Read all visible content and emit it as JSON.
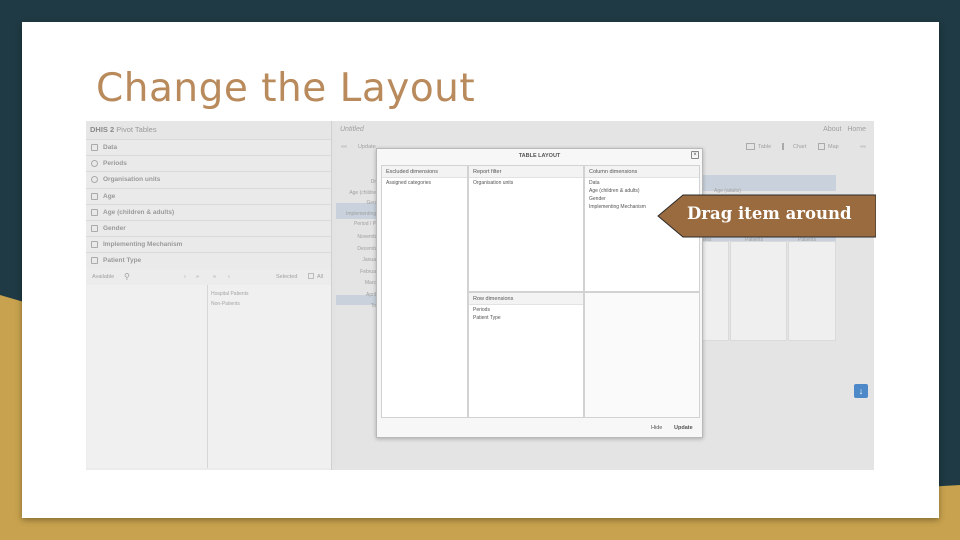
{
  "slide": {
    "title": "Change the Layout"
  },
  "app": {
    "brand": "DHIS 2",
    "name": "Pivot Tables",
    "accordion": [
      "Data",
      "Periods",
      "Organisation units",
      "Age",
      "Age (children & adults)",
      "Gender",
      "Implementing Mechanism",
      "Patient Type"
    ],
    "selector": {
      "available": "Available",
      "selected": "Selected",
      "all": "All"
    },
    "selected_items": [
      "Hospital Patients",
      "Non-Patients"
    ]
  },
  "main": {
    "favorite": "Untitled",
    "about": "About",
    "home": "Home",
    "update": "Update",
    "table": "Table",
    "chart": "Chart",
    "map": "Map",
    "grid": {
      "row_header_labels": [
        "Dr",
        "Age (childre",
        "Gen",
        "Implementing",
        "Period / P"
      ],
      "row_labels": [
        "Novemb",
        "Decemb",
        "Janua",
        "Februa",
        "Marc",
        "April",
        "To"
      ],
      "col_header": "Age (adults)",
      "col_labels": [
        "ents",
        "Patients",
        "Patients"
      ]
    }
  },
  "modal": {
    "title": "TABLE LAYOUT",
    "excluded": {
      "header": "Excluded dimensions",
      "items": [
        "Assigned categories"
      ]
    },
    "filter": {
      "header": "Report filter",
      "items": [
        "Organisation units"
      ]
    },
    "columns": {
      "header": "Column dimensions",
      "items": [
        "Data",
        "Age (children & adults)",
        "Gender",
        "Implementing Mechanism"
      ]
    },
    "rows": {
      "header": "Row dimensions",
      "items": [
        "Periods",
        "Patient Type"
      ]
    },
    "hide": "Hide",
    "update": "Update"
  },
  "callout": {
    "text": "Drag item around"
  },
  "colors": {
    "title": "#b88a5c",
    "callout_fill": "#9a6b3f",
    "background": "#1f3a44",
    "accent_gold": "#c8a24e"
  }
}
